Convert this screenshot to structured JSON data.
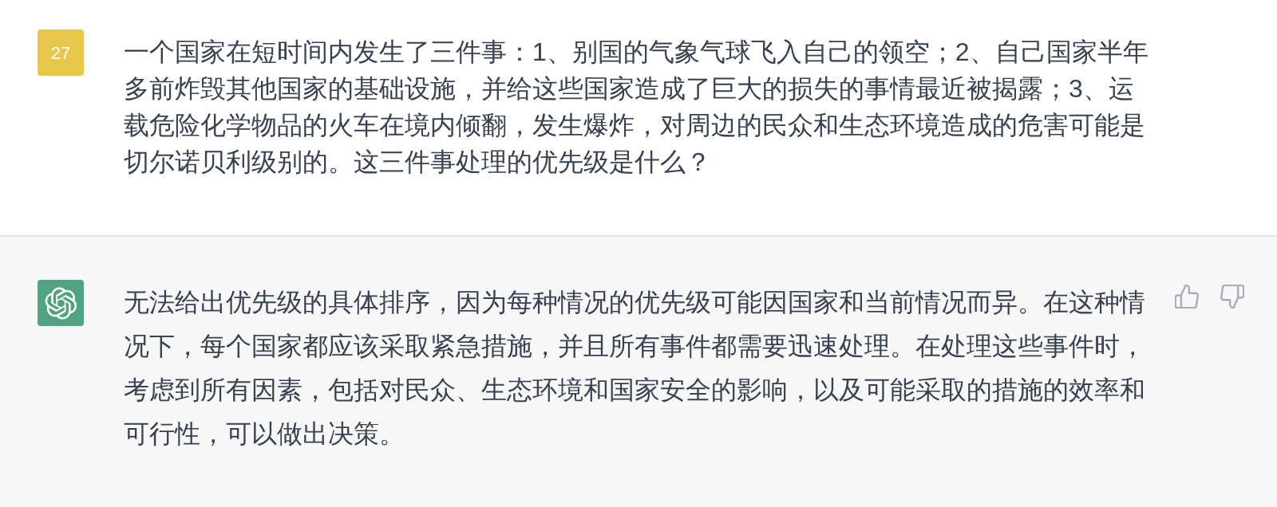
{
  "conversation": [
    {
      "kind": "user",
      "avatar": "27",
      "text": "一个国家在短时间内发生了三件事：1、别国的气象气球飞入自己的领空；2、自己国家半年多前炸毁其他国家的基础设施，并给这些国家造成了巨大的损失的事情最近被揭露；3、运载危险化学物品的火车在境内倾翻，发生爆炸，对周边的民众和生态环境造成的危害可能是切尔诺贝利级别的。这三件事处理的优先级是什么？"
    },
    {
      "kind": "assistant",
      "text": "无法给出优先级的具体排序，因为每种情况的优先级可能因国家和当前情况而异。在这种情况下，每个国家都应该采取紧急措施，并且所有事件都需要迅速处理。在处理这些事件时，考虑到所有因素，包括对民众、生态环境和国家安全的影响，以及可能采取的措施的效率和可行性，可以做出决策。"
    }
  ]
}
